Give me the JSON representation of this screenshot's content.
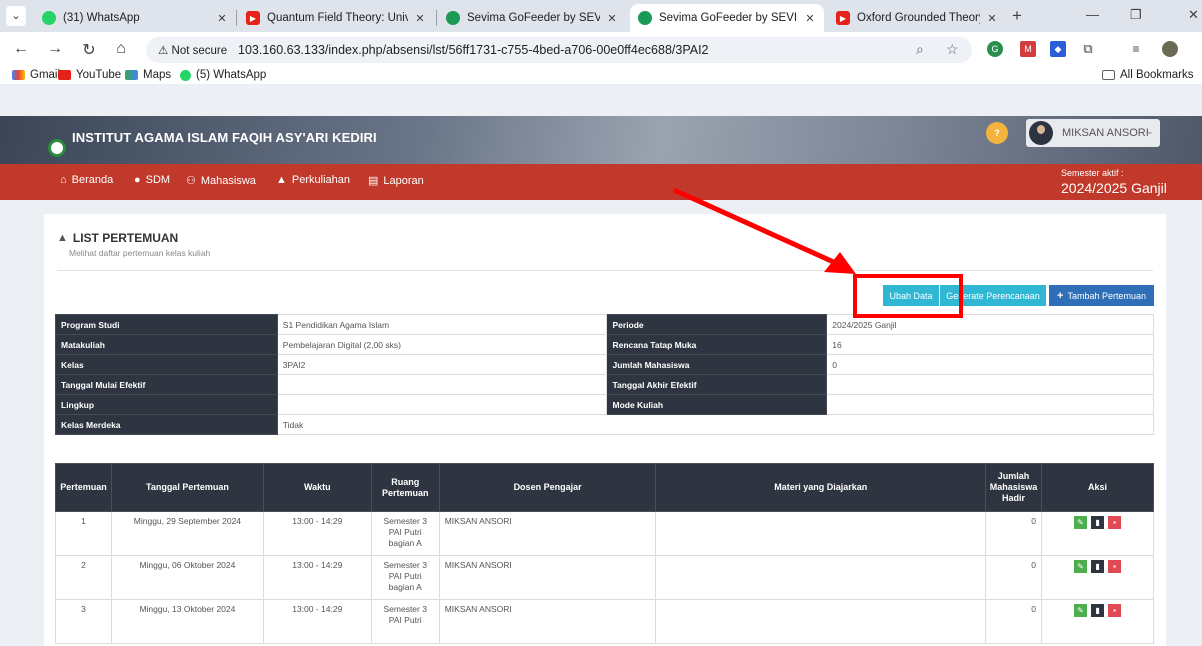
{
  "browser": {
    "tabs": [
      {
        "label": "(31) WhatsApp",
        "icon": "whatsapp-icon"
      },
      {
        "label": "Quantum Field Theory: Unive",
        "icon": "youtube-icon"
      },
      {
        "label": "Sevima GoFeeder by SEVIMA",
        "icon": "sevima-icon"
      },
      {
        "label": "Sevima GoFeeder by SEVIMA",
        "icon": "sevima-icon",
        "active": true
      },
      {
        "label": "Oxford Grounded Theory W",
        "icon": "youtube-icon"
      }
    ],
    "not_secure": "Not secure",
    "url": "103.160.63.133/index.php/absensi/lst/56ff1731-c755-4bed-a706-00e0ff4ec688/3PAI2",
    "bookmarks": [
      "Gmail",
      "YouTube",
      "Maps",
      "(5) WhatsApp"
    ],
    "all_bookmarks": "All Bookmarks"
  },
  "site": {
    "title": "INSTITUT AGAMA ISLAM FAQIH ASY'ARI KEDIRI",
    "user": "MIKSAN ANSORI",
    "nav": [
      "Beranda",
      "SDM",
      "Mahasiswa",
      "Perkuliahan",
      "Laporan"
    ],
    "semester_label": "Semester aktif :",
    "semester_value": "2024/2025 Ganjil"
  },
  "panel": {
    "title": "LIST PERTEMUAN",
    "subtitle": "Melihat daftar pertemuan kelas kuliah",
    "buttons": {
      "ubah": "Ubah Data",
      "generate": "Generate Perencanaan",
      "tambah": "Tambah Pertemuan"
    }
  },
  "info": [
    [
      "Program Studi",
      "S1 Pendidikan Agama Islam",
      "Periode",
      "2024/2025 Ganjil"
    ],
    [
      "Matakuliah",
      "Pembelajaran Digital (2,00 sks)",
      "Rencana Tatap Muka",
      "16"
    ],
    [
      "Kelas",
      "3PAI2",
      "Jumlah Mahasiswa",
      "0"
    ],
    [
      "Tanggal Mulai Efektif",
      "",
      "Tanggal Akhir Efektif",
      ""
    ],
    [
      "Lingkup",
      "",
      "Mode Kuliah",
      ""
    ],
    [
      "Kelas Merdeka",
      "Tidak"
    ]
  ],
  "table": {
    "headers": [
      "Pertemuan",
      "Tanggal Pertemuan",
      "Waktu",
      "Ruang Pertemuan",
      "Dosen Pengajar",
      "Materi yang Diajarkan",
      "Jumlah Mahasiswa Hadir",
      "Aksi"
    ],
    "rows": [
      {
        "no": "1",
        "tanggal": "Minggu, 29 September 2024",
        "waktu": "13:00 - 14:29",
        "ruang": "Semester 3 PAI Putri bagian A",
        "dosen": "MIKSAN ANSORI",
        "materi": "",
        "hadir": "0"
      },
      {
        "no": "2",
        "tanggal": "Minggu, 06 Oktober 2024",
        "waktu": "13:00 - 14:29",
        "ruang": "Semester 3 PAI Putri bagian A",
        "dosen": "MIKSAN ANSORI",
        "materi": "",
        "hadir": "0"
      },
      {
        "no": "3",
        "tanggal": "Minggu, 13 Oktober 2024",
        "waktu": "13:00 - 14:29",
        "ruang": "Semester 3 PAI Putri",
        "dosen": "MIKSAN ANSORI",
        "materi": "",
        "hadir": "0"
      }
    ]
  }
}
